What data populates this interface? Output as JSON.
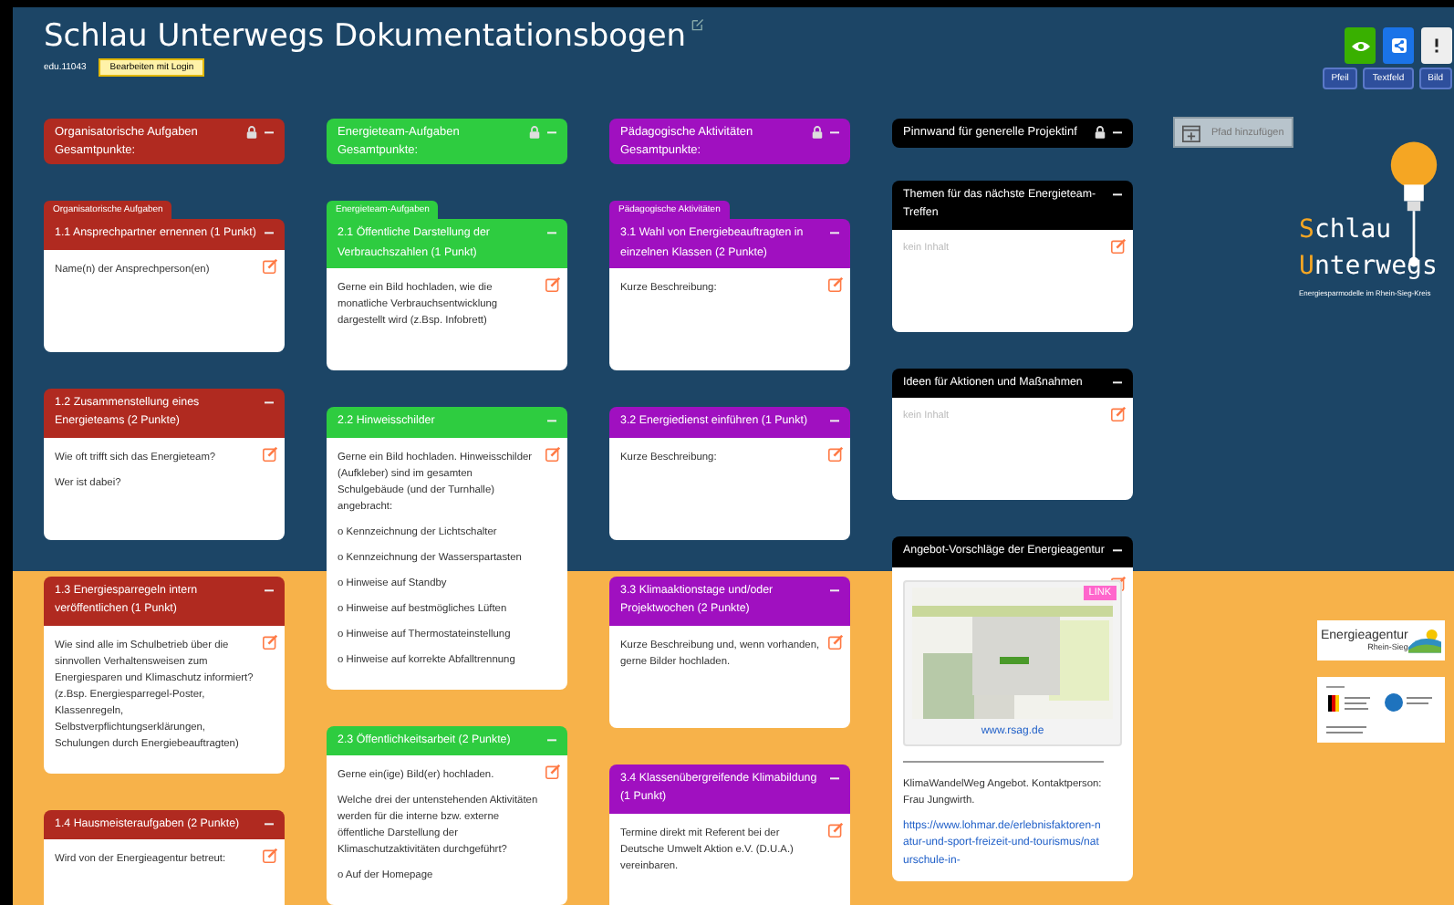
{
  "board": {
    "title": "Schlau Unterwegs Dokumentationsbogen",
    "code": "edu.11043",
    "login_button": "Bearbeiten mit Login"
  },
  "toolbar": {
    "tools": [
      "Pfeil",
      "Textfeld",
      "Bild"
    ]
  },
  "add_path_button": "Pfad hinzufügen",
  "logo": {
    "line_1": "Schlau",
    "line_2": "Unterwegs",
    "tagline": "Energiesparmodelle im Rhein-Sieg-Kreis"
  },
  "partner_logo": {
    "name": "Energieagentur",
    "region": "Rhein-Sieg"
  },
  "columns": [
    {
      "title": "Organisatorische Aufgaben",
      "subtitle": "Gesamtpunkte:",
      "color": "#b02a20",
      "locked": true,
      "tab": "Organisatorische Aufgaben",
      "cards": [
        {
          "title": "1.1 Ansprechpartner ernennen (1 Punkt)",
          "blocks": [
            {
              "kind": "text",
              "text": "Name(n) der Ansprechperson(en)"
            }
          ]
        },
        {
          "title": "1.2 Zusammenstellung eines Energieteams (2 Punkte)",
          "blocks": [
            {
              "kind": "text",
              "text": "Wie oft trifft sich das Energieteam?"
            },
            {
              "kind": "text",
              "text": "Wer ist dabei?"
            }
          ]
        },
        {
          "title": "1.3 Energiesparregeln intern veröffentlichen (1 Punkt)",
          "blocks": [
            {
              "kind": "text",
              "text": "Wie sind alle im Schulbetrieb über die sinnvollen Verhaltensweisen zum Energiesparen und Klimaschutz informiert? (z.Bsp. Energiesparregel-Poster, Klassenregeln, Selbstverpflichtungserklärungen, Schulungen durch Energiebeauftragten)"
            }
          ]
        },
        {
          "title": "1.4 Hausmeisteraufgaben (2 Punkte)",
          "blocks": [
            {
              "kind": "text",
              "text": "Wird von der Energieagentur betreut:"
            }
          ]
        }
      ]
    },
    {
      "title": "Energieteam-Aufgaben",
      "subtitle": "Gesamtpunkte:",
      "color": "#2ecc40",
      "locked": true,
      "tab": "Energieteam-Aufgaben",
      "cards": [
        {
          "title": "2.1 Öffentliche Darstellung der Verbrauchszahlen (1 Punkt)",
          "blocks": [
            {
              "kind": "text",
              "text": "Gerne ein Bild hochladen, wie die monatliche Verbrauchsentwicklung dargestellt wird (z.Bsp. Infobrett)"
            }
          ]
        },
        {
          "title": "2.2 Hinweisschilder",
          "blocks": [
            {
              "kind": "text",
              "text": "Gerne ein Bild hochladen. Hinweisschilder (Aufkleber) sind im gesamten Schulgebäude (und der Turnhalle) angebracht:"
            },
            {
              "kind": "text",
              "text": "o Kennzeichnung der Lichtschalter"
            },
            {
              "kind": "text",
              "text": "o Kennzeichnung der Wasserspartasten"
            },
            {
              "kind": "text",
              "text": "o Hinweise auf Standby"
            },
            {
              "kind": "text",
              "text": "o Hinweise auf bestmögliches Lüften"
            },
            {
              "kind": "text",
              "text": "o Hinweise auf Thermostateinstellung"
            },
            {
              "kind": "text",
              "text": "o Hinweise auf korrekte Abfalltrennung"
            }
          ]
        },
        {
          "title": "2.3 Öffentlichkeitsarbeit (2 Punkte)",
          "blocks": [
            {
              "kind": "text",
              "text": "Gerne ein(ige) Bild(er) hochladen."
            },
            {
              "kind": "text",
              "text": "Welche drei der untenstehenden Aktivitäten werden für die interne bzw. externe öffentliche Darstellung der Klimaschutzaktivitäten durchgeführt?"
            },
            {
              "kind": "text",
              "text": "o Auf der Homepage"
            }
          ]
        }
      ]
    },
    {
      "title": "Pädagogische Aktivitäten",
      "subtitle": "Gesamtpunkte:",
      "color": "#a010c0",
      "locked": true,
      "tab": "Pädagogische Aktivitäten",
      "cards": [
        {
          "title": "3.1 Wahl von Energiebeauftragten in einzelnen Klassen (2 Punkte)",
          "blocks": [
            {
              "kind": "text",
              "text": "Kurze Beschreibung:"
            }
          ]
        },
        {
          "title": "3.2 Energiedienst einführen (1 Punkt)",
          "blocks": [
            {
              "kind": "text",
              "text": "Kurze Beschreibung:"
            }
          ]
        },
        {
          "title": "3.3 Klimaaktionstage und/oder Projektwochen (2 Punkte)",
          "blocks": [
            {
              "kind": "text",
              "text": "Kurze Beschreibung und, wenn vorhanden, gerne Bilder hochladen."
            }
          ]
        },
        {
          "title": "3.4 Klassenübergreifende Klimabildung (1 Punkt)",
          "blocks": [
            {
              "kind": "text",
              "text": "Termine direkt mit Referent bei der Deutsche Umwelt Aktion e.V. (D.U.A.) vereinbaren."
            }
          ]
        }
      ]
    },
    {
      "title": "Pinnwand für generelle Projektinf",
      "color": "#000000",
      "locked": true,
      "cards": [
        {
          "title": "Themen für das nächste Energieteam-Treffen",
          "blocks": [
            {
              "kind": "empty",
              "text": "kein Inhalt"
            }
          ]
        },
        {
          "title": "Ideen für Aktionen und Maßnahmen",
          "blocks": [
            {
              "kind": "empty",
              "text": "kein Inhalt"
            }
          ]
        },
        {
          "title": "Angebot-Vorschläge der Energieagentur",
          "blocks": [
            {
              "kind": "preview",
              "badge": "LINK",
              "url": "www.rsag.de"
            },
            {
              "kind": "rule"
            },
            {
              "kind": "text",
              "text": "KlimaWandelWeg Angebot. Kontaktperson: Frau Jungwirth."
            },
            {
              "kind": "link",
              "text": "https://www.lohmar.de/erlebnisfaktoren-natur-und-sport-freizeit-und-tourismus/naturschule-in-"
            }
          ]
        }
      ]
    }
  ]
}
